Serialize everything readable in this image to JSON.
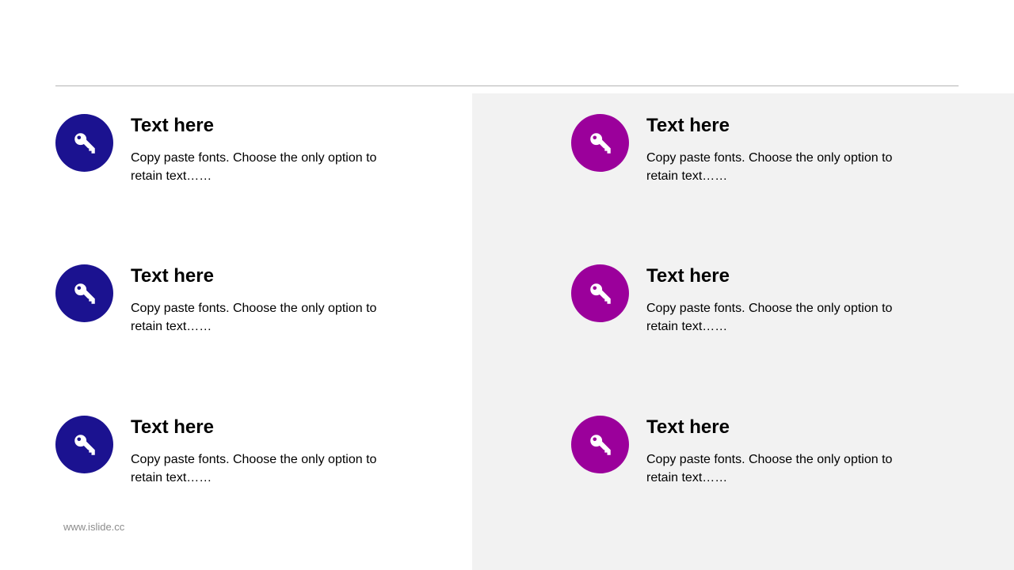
{
  "colors": {
    "left_accent": "#1b1290",
    "right_accent": "#9b009b",
    "divider": "#b4b4b4",
    "panel_bg": "#f2f2f2"
  },
  "items_left": [
    {
      "title": "Text here",
      "desc": "Copy paste fonts. Choose the only option to retain text……",
      "icon": "key-icon"
    },
    {
      "title": "Text here",
      "desc": "Copy paste fonts. Choose the only option to retain text……",
      "icon": "key-icon"
    },
    {
      "title": "Text here",
      "desc": "Copy paste fonts. Choose the only option to retain text……",
      "icon": "key-icon"
    }
  ],
  "items_right": [
    {
      "title": "Text here",
      "desc": "Copy paste fonts. Choose the only option to retain text……",
      "icon": "key-icon"
    },
    {
      "title": "Text here",
      "desc": "Copy paste fonts. Choose the only option to retain text……",
      "icon": "key-icon"
    },
    {
      "title": "Text here",
      "desc": "Copy paste fonts. Choose the only option to retain text……",
      "icon": "key-icon"
    }
  ],
  "footer": {
    "text": "www.islide.cc"
  }
}
